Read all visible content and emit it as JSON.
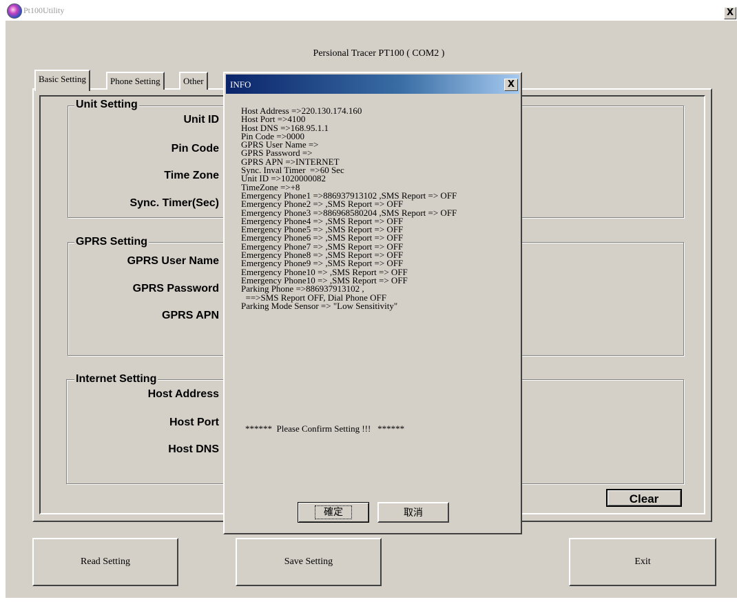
{
  "window": {
    "title": "Pt100Utility",
    "close_label": "X"
  },
  "main": {
    "caption": "Persional Tracer PT100 ( COM2 )"
  },
  "tabs": [
    {
      "label": "Basic Setting"
    },
    {
      "label": "Phone Setting"
    },
    {
      "label": "Other"
    }
  ],
  "unit_setting": {
    "title": "Unit Setting",
    "labels": [
      "Unit ID",
      "Pin Code",
      "Time Zone",
      "Sync. Timer(Sec)"
    ]
  },
  "gprs_setting": {
    "title": "GPRS Setting",
    "labels": [
      "GPRS User Name",
      "GPRS Password",
      "GPRS APN"
    ]
  },
  "internet_setting": {
    "title": "Internet Setting",
    "labels": [
      "Host Address",
      "Host Port",
      "Host DNS"
    ]
  },
  "buttons": {
    "clear": "Clear",
    "read": "Read Setting",
    "save": "Save Setting",
    "exit": "Exit"
  },
  "dialog": {
    "title": "INFO",
    "close_label": "X",
    "lines": [
      "Host Address =>220.130.174.160",
      "Host Port =>4100",
      "Host DNS =>168.95.1.1",
      "Pin Code =>0000",
      "GPRS User Name =>",
      "GPRS Password =>",
      "GPRS APN =>INTERNET",
      "Sync. Inval Timer  =>60 Sec",
      "Unit ID =>1020000082",
      "TimeZone =>+8",
      "Emergency Phone1 =>886937913102 ,SMS Report => OFF",
      "Emergency Phone2 => ,SMS Report => OFF",
      "Emergency Phone3 =>886968580204 ,SMS Report => OFF",
      "Emergency Phone4 => ,SMS Report => OFF",
      "Emergency Phone5 => ,SMS Report => OFF",
      "Emergency Phone6 => ,SMS Report => OFF",
      "Emergency Phone7 => ,SMS Report => OFF",
      "Emergency Phone8 => ,SMS Report => OFF",
      "Emergency Phone9 => ,SMS Report => OFF",
      "Emergency Phone10 => ,SMS Report => OFF",
      "Emergency Phone10 => ,SMS Report => OFF",
      "Parking Phone =>886937913102 ,",
      "  ==>SMS Report OFF, Dial Phone OFF",
      "Parking Mode Sensor => \"Low Sensitivity\""
    ],
    "confirm": "******  Please Confirm Setting !!!   ******",
    "ok_label": "確定",
    "cancel_label": "取消"
  }
}
